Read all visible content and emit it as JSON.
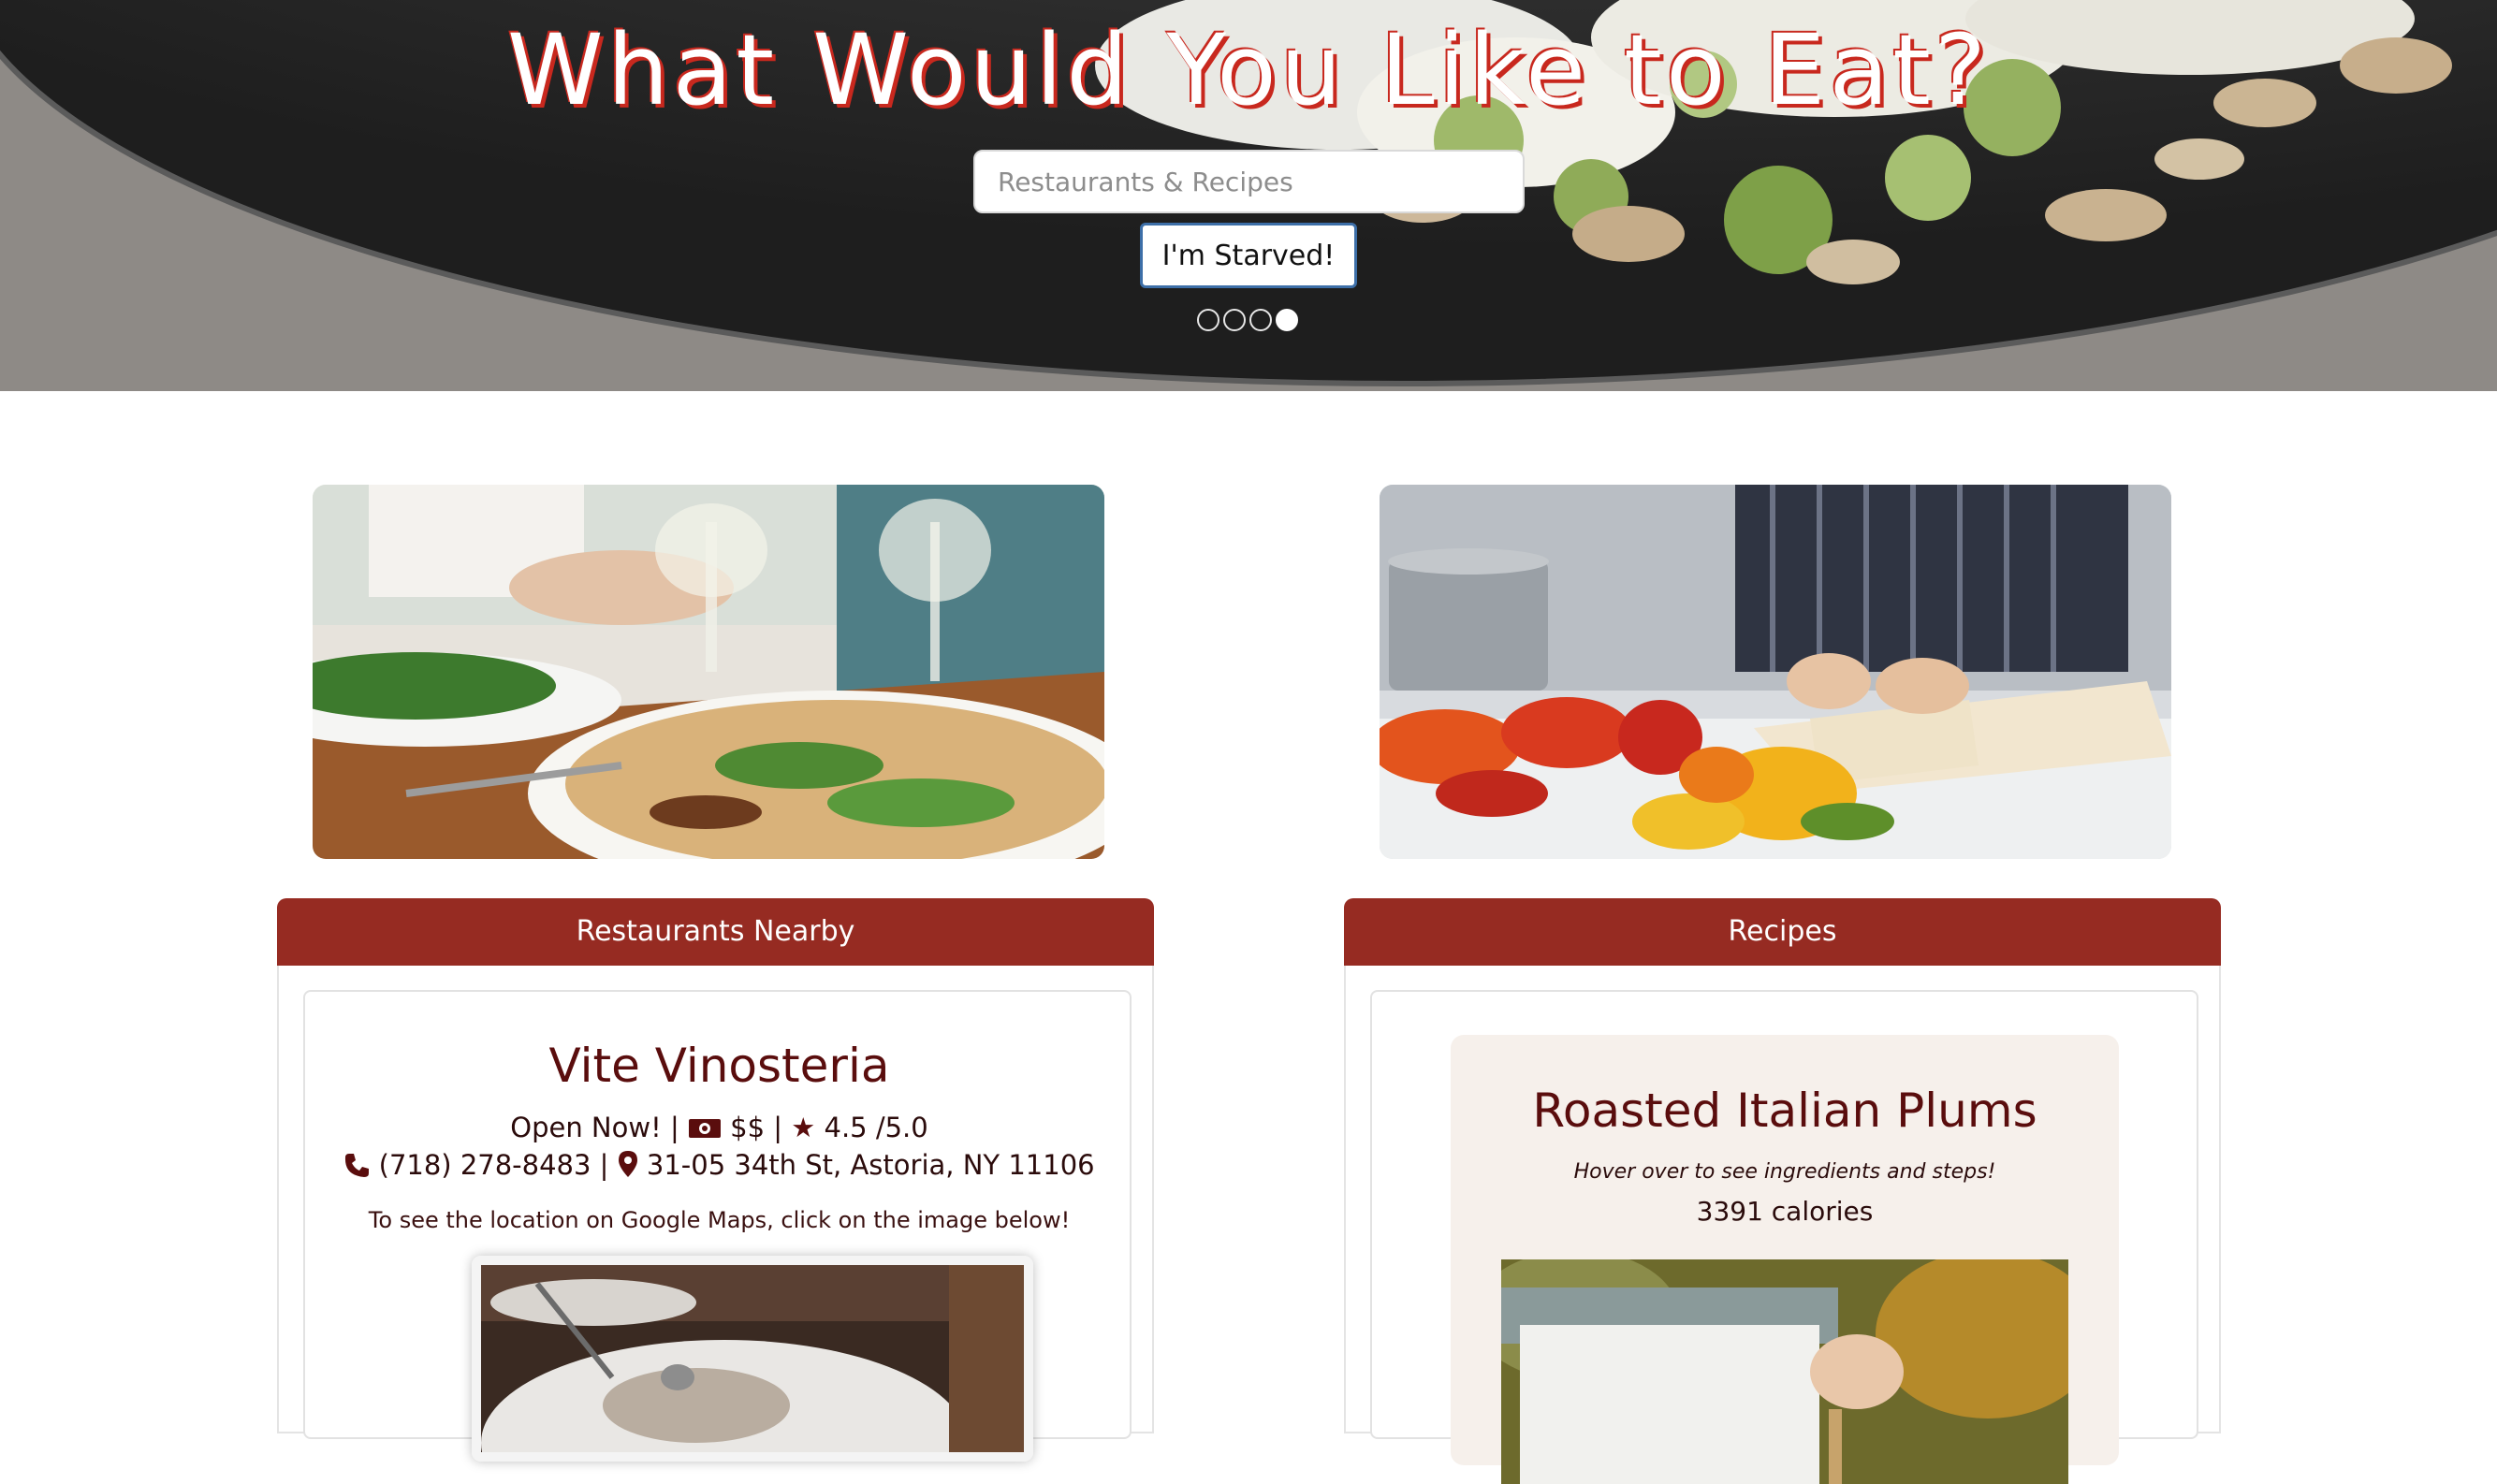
{
  "hero": {
    "title": "What Would You Like to Eat?",
    "search_placeholder": "Restaurants & Recipes",
    "button_label": "I'm Starved!",
    "carousel": {
      "slide_count": 4,
      "active_index": 3
    }
  },
  "restaurants": {
    "header": "Restaurants Nearby",
    "name": "Vite Vinosteria",
    "status": "Open Now!",
    "price": "$$",
    "rating": "4.5 /5.0",
    "phone": "(718) 278-8483",
    "address": "31-05 34th St, Astoria, NY 11106",
    "map_note": "To see the location on Google Maps, click on the image below!",
    "separator": "|"
  },
  "recipes": {
    "header": "Recipes",
    "title": "Roasted Italian Plums",
    "hint": "Hover over to see ingredients and steps!",
    "calories": "3391 calories"
  },
  "icons": {
    "money": "money-icon",
    "star": "star-icon",
    "phone": "phone-icon",
    "location": "map-pin-icon"
  },
  "colors": {
    "accent": "#962b22",
    "title_text": "#5a0d0d",
    "hero_title_shadow": "#c8281e",
    "recipe_card_bg": "#f6f0eb"
  }
}
